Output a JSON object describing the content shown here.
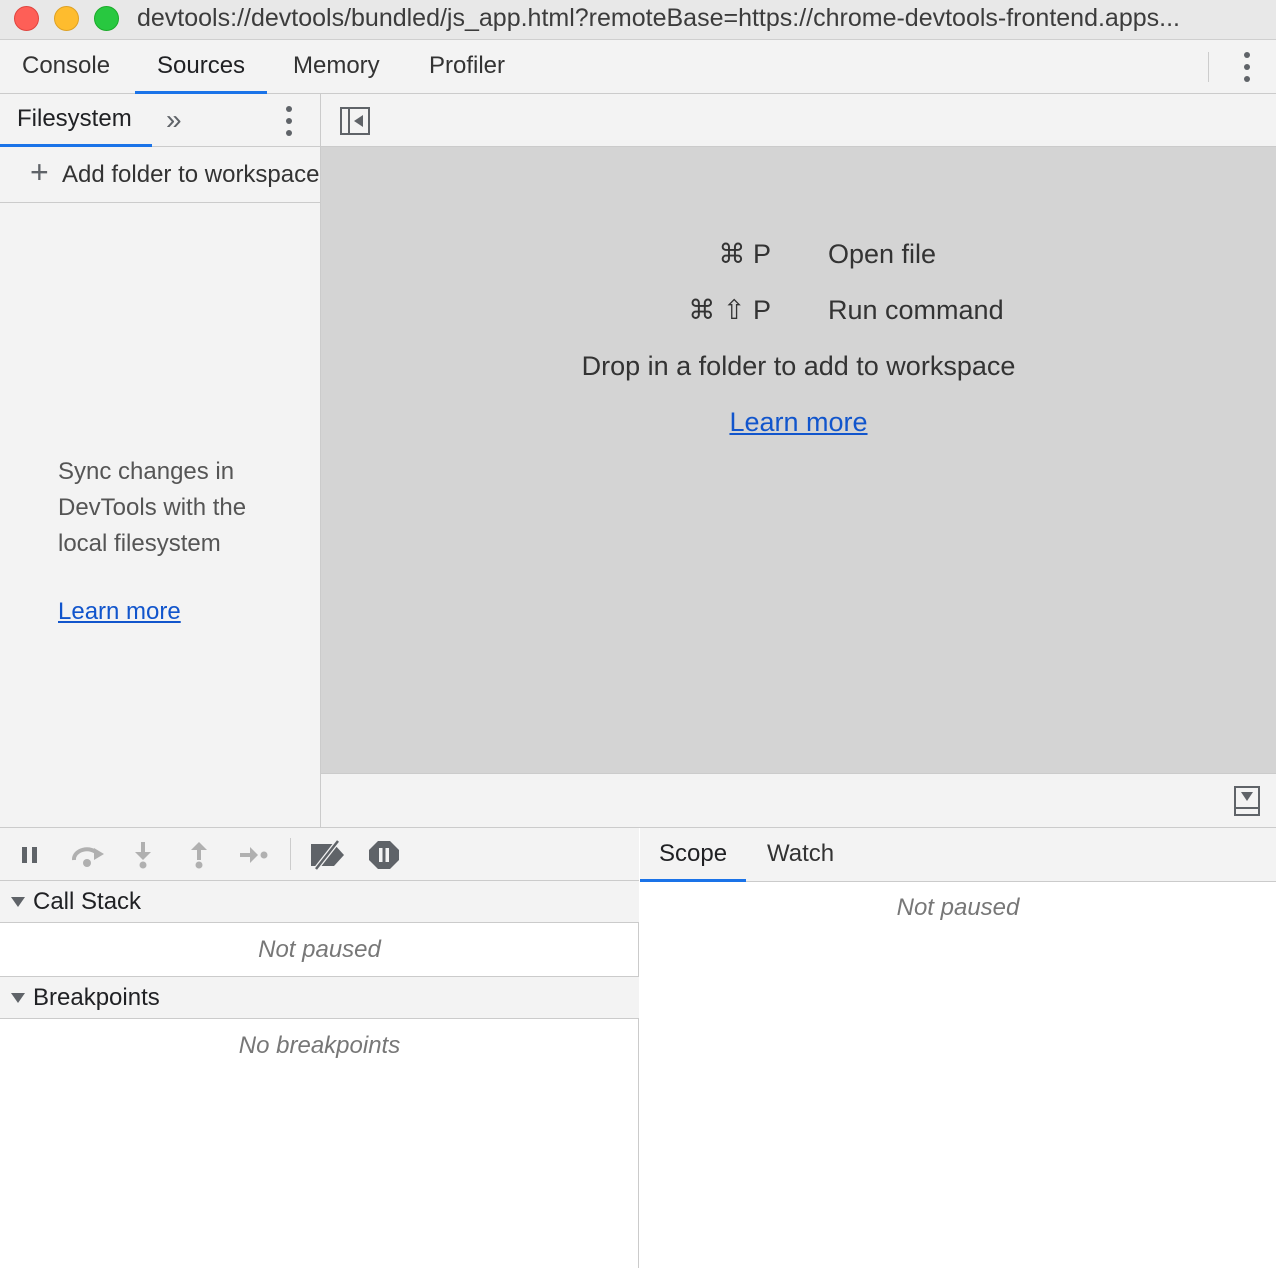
{
  "window": {
    "url": "devtools://devtools/bundled/js_app.html?remoteBase=https://chrome-devtools-frontend.apps..."
  },
  "main_tabs": [
    {
      "label": "Console",
      "active": false
    },
    {
      "label": "Sources",
      "active": true
    },
    {
      "label": "Memory",
      "active": false
    },
    {
      "label": "Profiler",
      "active": false
    }
  ],
  "navigator": {
    "tab_label": "Filesystem",
    "more_tabs_glyph": "»",
    "add_folder_label": "Add folder to workspace",
    "sync_message": "Sync changes in DevTools with the local filesystem",
    "learn_more": "Learn more"
  },
  "editor": {
    "shortcuts": [
      {
        "keys": "⌘ P",
        "description": "Open file"
      },
      {
        "keys": "⌘ ⇧ P",
        "description": "Run command"
      }
    ],
    "drop_text": "Drop in a folder to add to workspace",
    "learn_more": "Learn more"
  },
  "debugger": {
    "call_stack": {
      "title": "Call Stack",
      "status": "Not paused"
    },
    "breakpoints": {
      "title": "Breakpoints",
      "status": "No breakpoints"
    },
    "right_tabs": [
      {
        "label": "Scope",
        "active": true
      },
      {
        "label": "Watch",
        "active": false
      }
    ],
    "scope_status": "Not paused"
  },
  "colors": {
    "accent": "#1a73e8",
    "link": "#1155cc",
    "panel_bg": "#f3f3f3",
    "editor_placeholder_bg": "#d4d4d4"
  }
}
